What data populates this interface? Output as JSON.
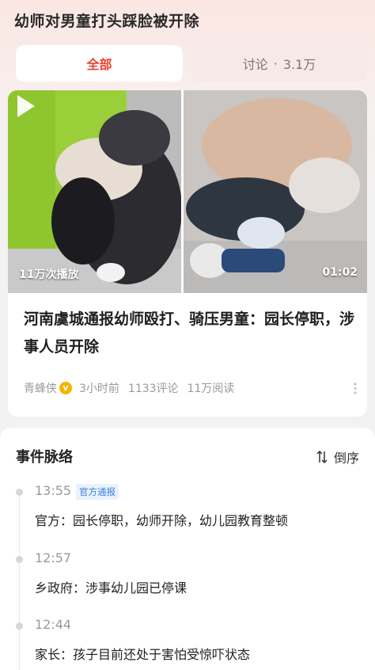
{
  "topic": {
    "title": "幼师对男童打头踩脸被开除"
  },
  "tabs": {
    "all": "全部",
    "discuss_label": "讨论",
    "discuss_sep": "·",
    "discuss_count": "3.1万"
  },
  "video": {
    "views": "11万次播放",
    "duration": "01:02"
  },
  "article": {
    "headline": "河南虞城通报幼师殴打、骑压男童：园长停职，涉事人员开除",
    "source": "青蜂侠",
    "time": "3小时前",
    "comments": "1133评论",
    "reads": "11万阅读"
  },
  "timeline": {
    "title": "事件脉络",
    "sort_label": "倒序",
    "events": [
      {
        "time": "13:55",
        "tag": "官方通报",
        "text": "官方：园长停职，幼师开除，幼儿园教育整顿"
      },
      {
        "time": "12:57",
        "tag": "",
        "text": "乡政府：涉事幼儿园已停课"
      },
      {
        "time": "12:44",
        "tag": "",
        "text": "家长：孩子目前还处于害怕受惊吓状态"
      }
    ]
  },
  "colors": {
    "accent": "#e8412e",
    "official_tag": "#3b82d6"
  }
}
